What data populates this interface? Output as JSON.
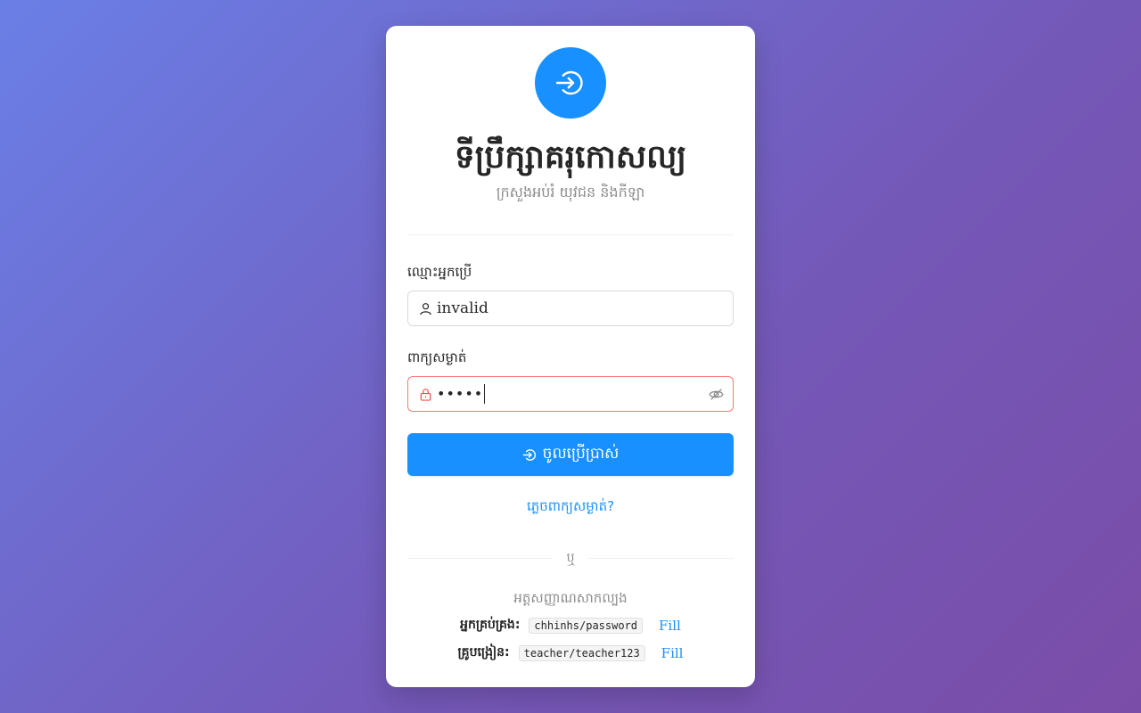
{
  "app": {
    "title": "ទីប្រឹក្សាគរុកោសល្យ",
    "subtitle": "ក្រសួងអប់រំ យុវជន និងកីឡា"
  },
  "form": {
    "username_label": "ឈ្មោះអ្នកប្រើ",
    "username_value": "invalid",
    "password_label": "ពាក្យសម្ងាត់",
    "password_mask": "•••••",
    "login_button": "ចូលប្រើប្រាស់",
    "forgot_link": "ភ្លេចពាក្យសម្ងាត់?"
  },
  "divider": {
    "or_text": "ឬ"
  },
  "demo": {
    "title": "អត្តសញ្ញាណសាកល្បង",
    "accounts": [
      {
        "label": "អ្នកគ្រប់គ្រង:",
        "credentials": "chhinhs/password",
        "fill": "Fill"
      },
      {
        "label": "គ្រូបង្រៀន:",
        "credentials": "teacher/teacher123",
        "fill": "Fill"
      }
    ]
  },
  "colors": {
    "primary": "#1890ff",
    "error_border": "#ff7875",
    "error_icon": "#ff4d4f"
  },
  "icons": {
    "logo": "login-icon",
    "username_prefix": "user-icon",
    "password_prefix": "lock-icon",
    "password_suffix": "eye-invisible-icon",
    "button": "login-icon"
  }
}
